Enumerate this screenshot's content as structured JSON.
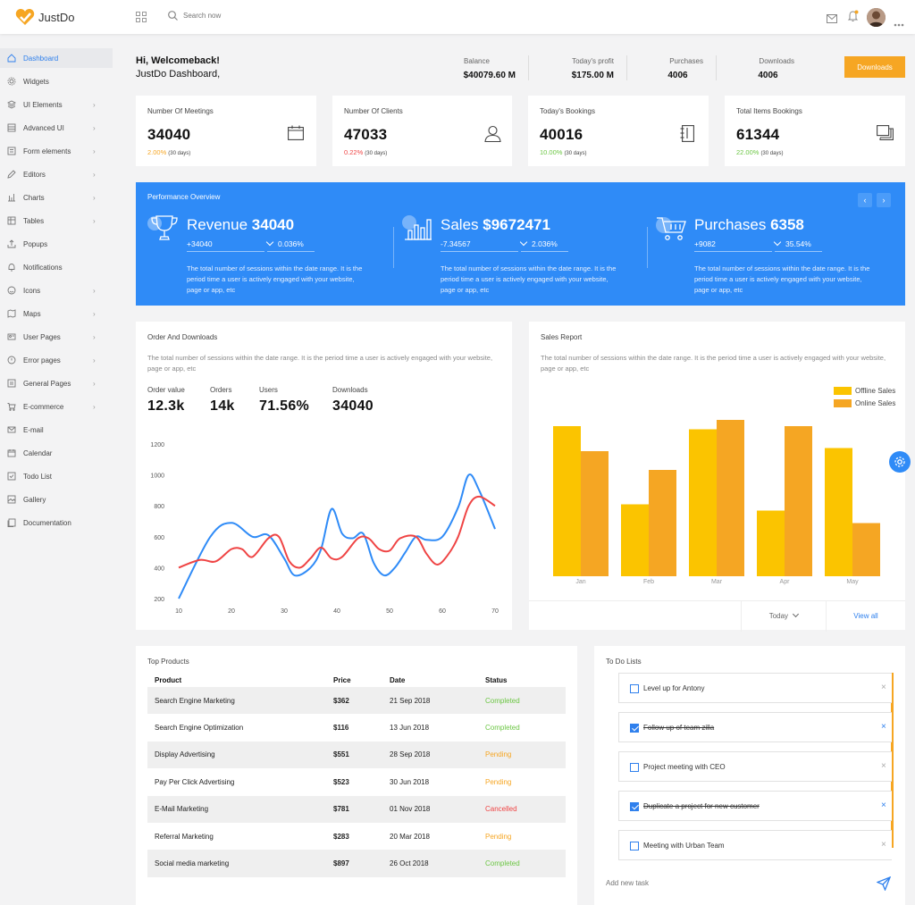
{
  "app": {
    "name": "JustDo"
  },
  "topbar": {
    "search_placeholder": "Search now"
  },
  "sidebar": {
    "items": [
      {
        "label": "Dashboard",
        "icon": "home-icon",
        "chev": false
      },
      {
        "label": "Widgets",
        "icon": "gear-icon",
        "chev": false
      },
      {
        "label": "UI Elements",
        "icon": "layers-icon",
        "chev": true
      },
      {
        "label": "Advanced UI",
        "icon": "list-icon",
        "chev": true
      },
      {
        "label": "Form elements",
        "icon": "form-icon",
        "chev": true
      },
      {
        "label": "Editors",
        "icon": "pencil-icon",
        "chev": true
      },
      {
        "label": "Charts",
        "icon": "bar-chart-icon",
        "chev": true
      },
      {
        "label": "Tables",
        "icon": "table-icon",
        "chev": true
      },
      {
        "label": "Popups",
        "icon": "share-icon",
        "chev": false
      },
      {
        "label": "Notifications",
        "icon": "bell-icon",
        "chev": false
      },
      {
        "label": "Icons",
        "icon": "smiley-icon",
        "chev": true
      },
      {
        "label": "Maps",
        "icon": "map-icon",
        "chev": true
      },
      {
        "label": "User Pages",
        "icon": "user-card-icon",
        "chev": true
      },
      {
        "label": "Error pages",
        "icon": "alert-icon",
        "chev": true
      },
      {
        "label": "General Pages",
        "icon": "page-icon",
        "chev": true
      },
      {
        "label": "E-commerce",
        "icon": "cart-icon",
        "chev": true
      },
      {
        "label": "E-mail",
        "icon": "mail-icon",
        "chev": false
      },
      {
        "label": "Calendar",
        "icon": "calendar-icon",
        "chev": false
      },
      {
        "label": "Todo List",
        "icon": "checkbox-icon",
        "chev": false
      },
      {
        "label": "Gallery",
        "icon": "image-icon",
        "chev": false
      },
      {
        "label": "Documentation",
        "icon": "docs-icon",
        "chev": false
      }
    ]
  },
  "header": {
    "greeting": "Hi, Welcomeback!",
    "subtitle": "JustDo Dashboard,",
    "stats": [
      {
        "label": "Balance",
        "value": "$40079.60 M"
      },
      {
        "label": "Today's profit",
        "value": "$175.00 M"
      },
      {
        "label": "Purchases",
        "value": "4006"
      },
      {
        "label": "Downloads",
        "value": "4006"
      }
    ],
    "downloads_button": "Downloads"
  },
  "kpis": [
    {
      "label": "Number Of Meetings",
      "value": "34040",
      "pct": "2.00%",
      "pct_color": "#f6a623",
      "days": "(30 days)",
      "icon": "calendar-icon"
    },
    {
      "label": "Number Of Clients",
      "value": "47033",
      "pct": "0.22%",
      "pct_color": "#ef4444",
      "days": "(30 days)",
      "icon": "user-icon"
    },
    {
      "label": "Today's Bookings",
      "value": "40016",
      "pct": "10.00%",
      "pct_color": "#6cc644",
      "days": "(30 days)",
      "icon": "book-icon"
    },
    {
      "label": "Total Items Bookings",
      "value": "61344",
      "pct": "22.00%",
      "pct_color": "#6cc644",
      "days": "(30 days)",
      "icon": "copy-icon"
    }
  ],
  "performance": {
    "title": "Performance Overview",
    "columns": [
      {
        "name": "Revenue",
        "value": "34040",
        "delta": "+34040",
        "pct": "0.036%",
        "desc": "The total number of sessions within the date range. It is the period time a user is actively engaged with your website, page or app, etc",
        "icon": "trophy-icon"
      },
      {
        "name": "Sales",
        "value": "$9672471",
        "delta": "-7.34567",
        "pct": "2.036%",
        "desc": "The total number of sessions within the date range. It is the period time a user is actively engaged with your website, page or app, etc",
        "icon": "bar-chart-icon"
      },
      {
        "name": "Purchases",
        "value": "6358",
        "delta": "+9082",
        "pct": "35.54%",
        "desc": "The total number of sessions within the date range. It is the period time a user is actively engaged with your website, page or app, etc",
        "icon": "cart-icon"
      }
    ]
  },
  "orders": {
    "title": "Order And Downloads",
    "desc": "The total number of sessions within the date range. It is the period time a user is actively engaged with your website, page or app, etc",
    "metrics": [
      {
        "label": "Order value",
        "value": "12.3k"
      },
      {
        "label": "Orders",
        "value": "14k"
      },
      {
        "label": "Users",
        "value": "71.56%"
      },
      {
        "label": "Downloads",
        "value": "34040"
      }
    ]
  },
  "sales_report": {
    "title": "Sales Report",
    "desc": "The total number of sessions within the date range. It is the period time a user is actively engaged with your website, page or app, etc",
    "today_label": "Today",
    "view_all": "View all"
  },
  "chart_data": [
    {
      "type": "line",
      "x": [
        10,
        20,
        30,
        40,
        50,
        60,
        70
      ],
      "xlim": [
        10,
        70
      ],
      "ylim": [
        200,
        1200
      ],
      "yticks": [
        200,
        400,
        600,
        800,
        1000,
        1200
      ],
      "series": [
        {
          "color": "#2f8bf7",
          "points": [
            [
              10,
              200
            ],
            [
              16,
              600
            ],
            [
              20,
              690
            ],
            [
              24,
              600
            ],
            [
              27,
              610
            ],
            [
              30,
              460
            ],
            [
              32,
              350
            ],
            [
              35,
              400
            ],
            [
              37,
              520
            ],
            [
              39,
              780
            ],
            [
              41,
              620
            ],
            [
              43,
              590
            ],
            [
              45,
              620
            ],
            [
              47,
              430
            ],
            [
              49,
              350
            ],
            [
              51,
              400
            ],
            [
              53,
              500
            ],
            [
              55,
              600
            ],
            [
              57,
              580
            ],
            [
              60,
              600
            ],
            [
              63,
              790
            ],
            [
              65,
              1000
            ],
            [
              67,
              900
            ],
            [
              70,
              650
            ]
          ]
        },
        {
          "color": "#ef4444",
          "points": [
            [
              10,
              400
            ],
            [
              14,
              450
            ],
            [
              17,
              440
            ],
            [
              20,
              520
            ],
            [
              22,
              520
            ],
            [
              24,
              470
            ],
            [
              27,
              590
            ],
            [
              29,
              600
            ],
            [
              31,
              440
            ],
            [
              33,
              400
            ],
            [
              35,
              460
            ],
            [
              37,
              530
            ],
            [
              39,
              460
            ],
            [
              41,
              470
            ],
            [
              44,
              590
            ],
            [
              46,
              590
            ],
            [
              48,
              520
            ],
            [
              50,
              510
            ],
            [
              52,
              590
            ],
            [
              55,
              600
            ],
            [
              57,
              490
            ],
            [
              59,
              420
            ],
            [
              61,
              480
            ],
            [
              63,
              600
            ],
            [
              65,
              800
            ],
            [
              67,
              860
            ],
            [
              70,
              800
            ]
          ]
        }
      ]
    },
    {
      "type": "bar",
      "categories": [
        "Jan",
        "Feb",
        "Mar",
        "Apr",
        "May"
      ],
      "series": [
        {
          "name": "Offline Sales",
          "color": "#fbc400",
          "values": [
            96,
            46,
            94,
            42,
            82
          ]
        },
        {
          "name": "Online Sales",
          "color": "#f5a623",
          "values": [
            80,
            68,
            100,
            96,
            34
          ]
        }
      ],
      "ylim": [
        0,
        100
      ],
      "grid": false,
      "legend": "top-right"
    }
  ],
  "products": {
    "title": "Top Products",
    "headers": [
      "Product",
      "Price",
      "Date",
      "Status"
    ],
    "rows": [
      {
        "product": "Search Engine Marketing",
        "price": "$362",
        "date": "21 Sep 2018",
        "status": "Completed",
        "status_color": "#6cc644"
      },
      {
        "product": "Search Engine Optimization",
        "price": "$116",
        "date": "13 Jun 2018",
        "status": "Completed",
        "status_color": "#6cc644"
      },
      {
        "product": "Display Advertising",
        "price": "$551",
        "date": "28 Sep 2018",
        "status": "Pending",
        "status_color": "#f6a623"
      },
      {
        "product": "Pay Per Click Advertising",
        "price": "$523",
        "date": "30 Jun 2018",
        "status": "Pending",
        "status_color": "#f6a623"
      },
      {
        "product": "E-Mail Marketing",
        "price": "$781",
        "date": "01 Nov 2018",
        "status": "Cancelled",
        "status_color": "#ef4444"
      },
      {
        "product": "Referral Marketing",
        "price": "$283",
        "date": "20 Mar 2018",
        "status": "Pending",
        "status_color": "#f6a623"
      },
      {
        "product": "Social media marketing",
        "price": "$897",
        "date": "26 Oct 2018",
        "status": "Completed",
        "status_color": "#6cc644"
      }
    ]
  },
  "todo": {
    "title": "To Do Lists",
    "add_placeholder": "Add new task",
    "items": [
      {
        "text": "Level up for Antony",
        "done": false
      },
      {
        "text": "Follow up of team zilla",
        "done": true
      },
      {
        "text": "Project meeting with CEO",
        "done": false
      },
      {
        "text": "Duplicate a project for new customer",
        "done": true
      },
      {
        "text": "Meeting with Urban Team",
        "done": false
      }
    ]
  },
  "colors": {
    "accent": "#2f8bf7",
    "orange": "#f6a623",
    "green": "#6cc644",
    "red": "#ef4444"
  }
}
